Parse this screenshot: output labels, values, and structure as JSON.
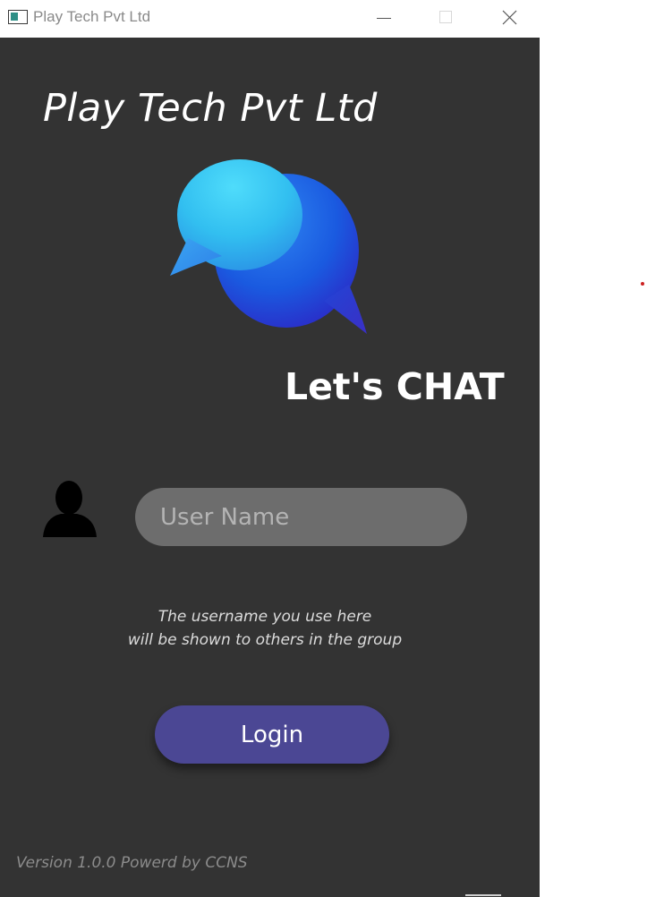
{
  "window": {
    "title": "Play Tech Pvt Ltd"
  },
  "header": {
    "company_name": "Play Tech Pvt Ltd",
    "logo_icon": "chat-bubbles-icon",
    "tagline": "Let's CHAT"
  },
  "login_form": {
    "user_icon": "user-silhouette-icon",
    "username_placeholder": "User Name",
    "username_value": "",
    "hint_line1": "The username you use here",
    "hint_line2": "will be shown to others in the group",
    "login_label": "Login"
  },
  "footer": {
    "version_text": "Version 1.0.0 Powerd by CCNS"
  },
  "colors": {
    "background": "#333333",
    "input_background": "#6d6d6d",
    "login_button": "#4b4794",
    "logo_light_blue": "#35c6f0",
    "logo_dark_blue": "#1a4fd8"
  }
}
